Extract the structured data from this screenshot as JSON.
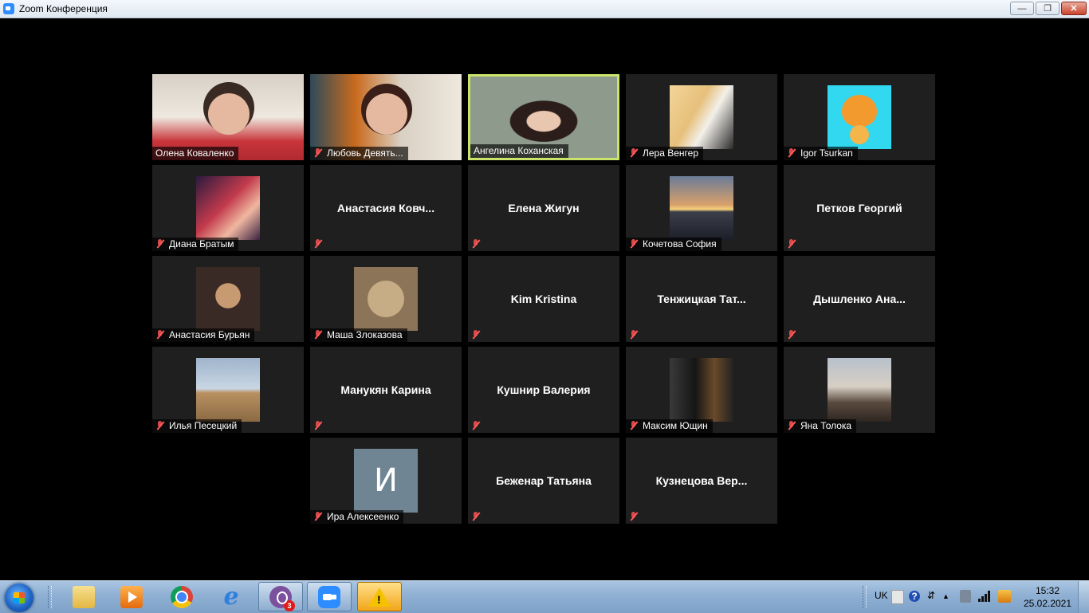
{
  "window": {
    "title": "Zoom Конференция",
    "min_glyph": "—",
    "max_glyph": "❐",
    "close_glyph": "✕"
  },
  "participants": [
    {
      "name": "Олена Коваленко",
      "muted": false,
      "tile": "video"
    },
    {
      "name": "Любовь Девять...",
      "muted": true,
      "tile": "video"
    },
    {
      "name": "Ангелина Коханская",
      "muted": false,
      "tile": "video",
      "active_speaker": true
    },
    {
      "name": "Лера Венгер",
      "muted": true,
      "tile": "avatar",
      "icon": "blonde-girl-cat-avatar"
    },
    {
      "name": "Igor Tsurkan",
      "muted": true,
      "tile": "avatar",
      "icon": "tiger-cartoon-avatar"
    },
    {
      "name": "Диана Братым",
      "muted": true,
      "tile": "avatar",
      "icon": "anime-girl-avatar"
    },
    {
      "name": "Анастасия  Ковч...",
      "muted": true,
      "tile": "name"
    },
    {
      "name": "Елена Жигун",
      "muted": true,
      "tile": "name"
    },
    {
      "name": "Кочетова София",
      "muted": true,
      "tile": "avatar",
      "icon": "sunset-sea-avatar"
    },
    {
      "name": "Петков Георгий",
      "muted": true,
      "tile": "name"
    },
    {
      "name": "Анастасия Бурьян",
      "muted": true,
      "tile": "avatar",
      "icon": "kitten-avatar"
    },
    {
      "name": "Маша Злоказова",
      "muted": true,
      "tile": "avatar",
      "icon": "cat-face-avatar"
    },
    {
      "name": "Kim Kristina",
      "muted": true,
      "tile": "name"
    },
    {
      "name": "Тенжицкая  Тат...",
      "muted": true,
      "tile": "name"
    },
    {
      "name": "Дышленко  Ана...",
      "muted": true,
      "tile": "name"
    },
    {
      "name": "Илья Песецкий",
      "muted": true,
      "tile": "avatar",
      "icon": "wheat-field-avatar"
    },
    {
      "name": "Манукян Карина",
      "muted": true,
      "tile": "name"
    },
    {
      "name": "Кушнир Валерия",
      "muted": true,
      "tile": "name"
    },
    {
      "name": "Максим Ющин",
      "muted": true,
      "tile": "avatar",
      "icon": "vortex-poster-avatar"
    },
    {
      "name": "Яна Толока",
      "muted": true,
      "tile": "avatar",
      "icon": "girl-portrait-avatar"
    },
    {
      "name": "Ира Алексеенко",
      "muted": true,
      "tile": "avatar",
      "icon": "letter-avatar",
      "initial": "И"
    },
    {
      "name": "Беженар Татьяна",
      "muted": true,
      "tile": "name"
    },
    {
      "name": "Кузнецова  Вер...",
      "muted": true,
      "tile": "name"
    }
  ],
  "taskbar": {
    "apps": [
      {
        "name": "explorer",
        "icon": "folder-icon"
      },
      {
        "name": "media player",
        "icon": "media-player-icon"
      },
      {
        "name": "chrome",
        "icon": "chrome-icon"
      },
      {
        "name": "internet explorer",
        "icon": "ie-icon",
        "glyph": "e"
      },
      {
        "name": "viber",
        "icon": "viber-icon",
        "badge": "3"
      },
      {
        "name": "zoom",
        "icon": "zoom-icon"
      },
      {
        "name": "warning",
        "icon": "warning-icon",
        "glyph": "!"
      }
    ],
    "tray": {
      "language": "UK",
      "help_glyph": "?",
      "time": "15:32",
      "date": "25.02.2021"
    }
  },
  "colors": {
    "active_speaker_border": "#c9e36b",
    "tile_background": "#1f1f1f",
    "muted_icon": "#d84a4a"
  }
}
